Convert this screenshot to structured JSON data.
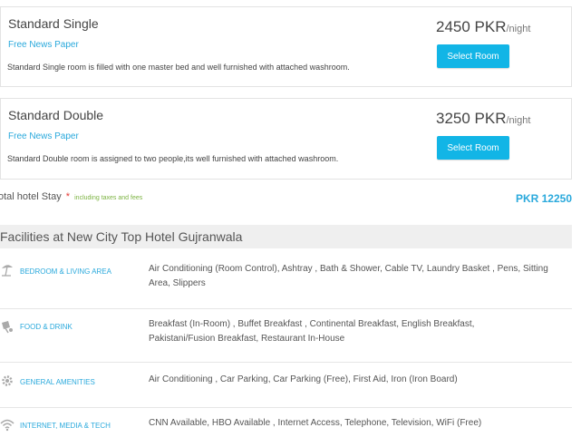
{
  "rooms": [
    {
      "name": "Standard Single",
      "feature": "Free News Paper",
      "description": "Standard Single room is filled with one master bed and well furnished with attached washroom.",
      "price": "2450 PKR",
      "per": "/night",
      "button": "Select Room"
    },
    {
      "name": "Standard Double",
      "feature": "Free News Paper",
      "description": "Standard Double room is assigned to two people,its well furnished with attached washroom.",
      "price": "3250 PKR",
      "per": "/night",
      "button": "Select Room"
    }
  ],
  "total": {
    "label": "otal hotel Stay",
    "star": "*",
    "taxes": "including taxes and fees",
    "amount": "PKR 12250"
  },
  "facilities": {
    "header": "Facilities at New City Top Hotel Gujranwala",
    "categories": [
      {
        "icon": "beach-umbrella-icon",
        "name": "BEDROOM & LIVING AREA",
        "items_line1": "Air Conditioning (Room Control), Ashtray , Bath & Shower, Cable TV, Laundry Basket , Pens, Sitting",
        "items_line2": "Area, Slippers"
      },
      {
        "icon": "food-drink-icon",
        "name": "FOOD & DRINK",
        "items_line1": "Breakfast (In-Room) , Buffet Breakfast , Continental Breakfast, English Breakfast,",
        "items_line2": "Pakistani/Fusion Breakfast, Restaurant In-House"
      },
      {
        "icon": "gear-icon",
        "name": "GENERAL AMENITIES",
        "items_line1": "Air Conditioning , Car Parking, Car Parking (Free), First Aid, Iron (Iron Board)",
        "items_line2": ""
      },
      {
        "icon": "wifi-icon",
        "name": "INTERNET, MEDIA & TECH",
        "items_line1": "CNN Available, HBO Available , Internet Access, Telephone, Television, WiFi (Free)",
        "items_line2": ""
      }
    ]
  },
  "colors": {
    "accent": "#2aa9dc",
    "button": "#12b5e6",
    "required": "#e53935",
    "taxes": "#7cb342",
    "header_bg": "#efefef"
  }
}
